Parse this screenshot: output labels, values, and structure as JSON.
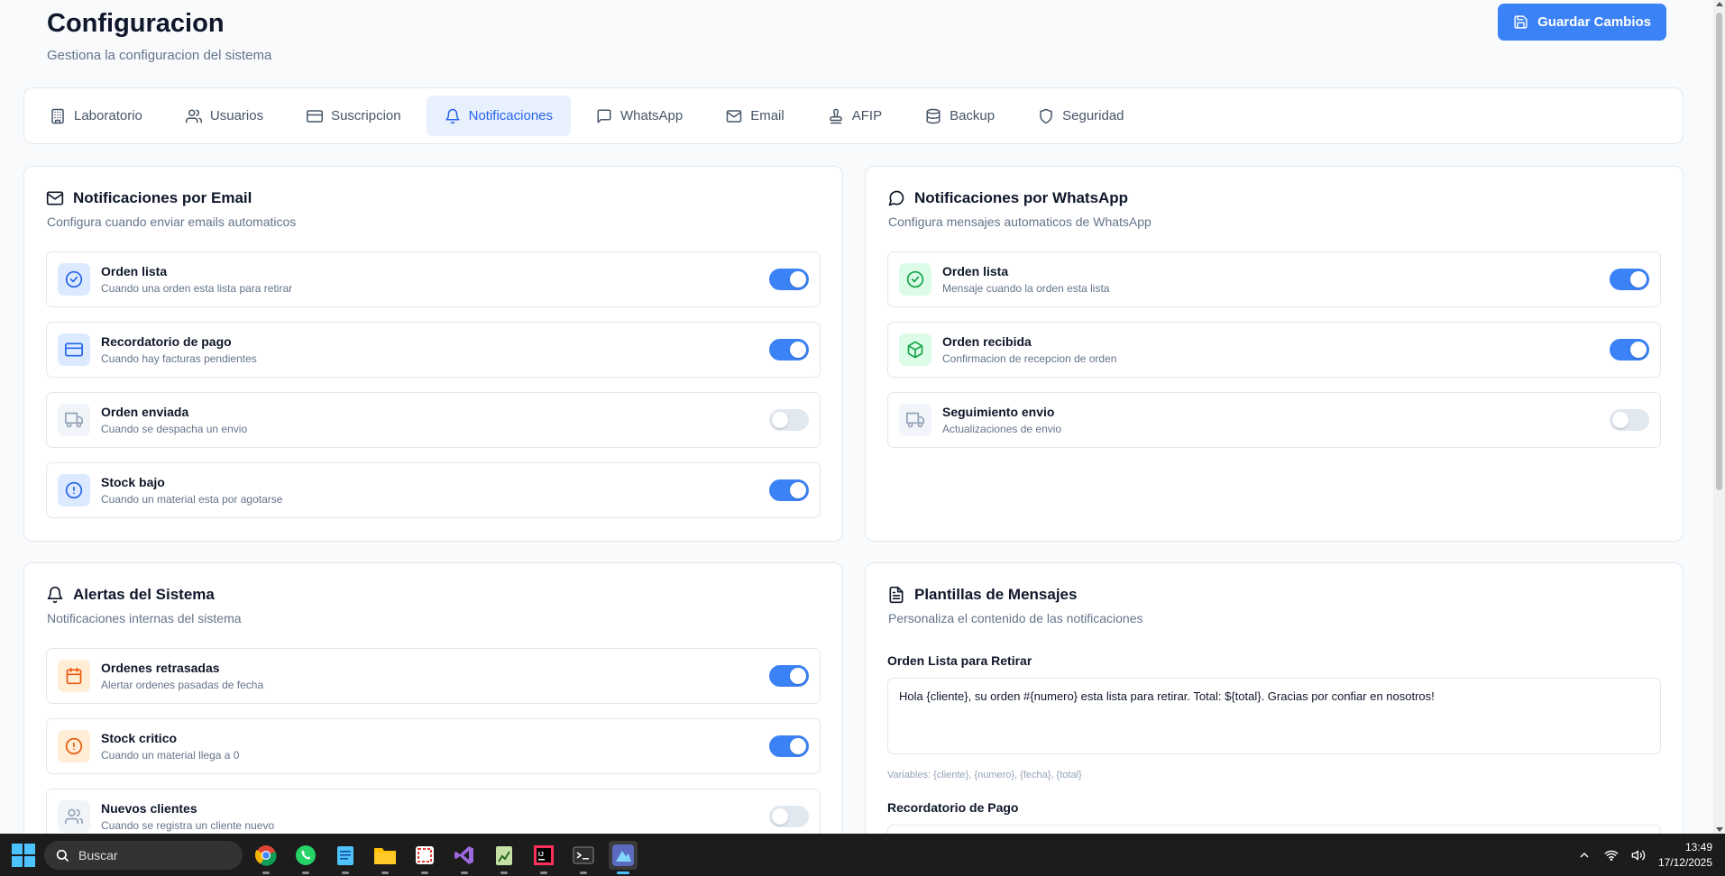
{
  "header": {
    "title": "Configuracion",
    "subtitle": "Gestiona la configuracion del sistema",
    "save_label": "Guardar Cambios"
  },
  "tabs": [
    {
      "label": "Laboratorio",
      "icon": "building-icon"
    },
    {
      "label": "Usuarios",
      "icon": "users-icon"
    },
    {
      "label": "Suscripcion",
      "icon": "credit-card-icon"
    },
    {
      "label": "Notificaciones",
      "icon": "bell-icon",
      "active": true
    },
    {
      "label": "WhatsApp",
      "icon": "message-icon"
    },
    {
      "label": "Email",
      "icon": "mail-icon"
    },
    {
      "label": "AFIP",
      "icon": "stamp-icon"
    },
    {
      "label": "Backup",
      "icon": "database-icon"
    },
    {
      "label": "Seguridad",
      "icon": "shield-icon"
    }
  ],
  "email_card": {
    "title": "Notificaciones por Email",
    "description": "Configura cuando enviar emails automaticos",
    "items": [
      {
        "label": "Orden lista",
        "sub": "Cuando una orden esta lista para retirar",
        "icon": "check-circle-icon",
        "enabled": true
      },
      {
        "label": "Recordatorio de pago",
        "sub": "Cuando hay facturas pendientes",
        "icon": "credit-card-icon",
        "enabled": true
      },
      {
        "label": "Orden enviada",
        "sub": "Cuando se despacha un envio",
        "icon": "truck-icon",
        "enabled": false
      },
      {
        "label": "Stock bajo",
        "sub": "Cuando un material esta por agotarse",
        "icon": "alert-circle-icon",
        "enabled": true
      }
    ]
  },
  "whatsapp_card": {
    "title": "Notificaciones por WhatsApp",
    "description": "Configura mensajes automaticos de WhatsApp",
    "items": [
      {
        "label": "Orden lista",
        "sub": "Mensaje cuando la orden esta lista",
        "icon": "check-circle-icon",
        "enabled": true
      },
      {
        "label": "Orden recibida",
        "sub": "Confirmacion de recepcion de orden",
        "icon": "package-icon",
        "enabled": true
      },
      {
        "label": "Seguimiento envio",
        "sub": "Actualizaciones de envio",
        "icon": "truck-icon",
        "enabled": false
      }
    ]
  },
  "alerts_card": {
    "title": "Alertas del Sistema",
    "description": "Notificaciones internas del sistema",
    "items": [
      {
        "label": "Ordenes retrasadas",
        "sub": "Alertar ordenes pasadas de fecha",
        "icon": "calendar-icon",
        "enabled": true
      },
      {
        "label": "Stock critico",
        "sub": "Cuando un material llega a 0",
        "icon": "alert-circle-icon",
        "enabled": true
      },
      {
        "label": "Nuevos clientes",
        "sub": "Cuando se registra un cliente nuevo",
        "icon": "users-icon",
        "enabled": false
      }
    ]
  },
  "templates_card": {
    "title": "Plantillas de Mensajes",
    "description": "Personaliza el contenido de las notificaciones",
    "template1_label": "Orden Lista para Retirar",
    "template1_value": "Hola {cliente}, su orden #{numero} esta lista para retirar. Total: ${total}. Gracias por confiar en nosotros!",
    "template1_vars": "Variables: {cliente}, {numero}, {fecha}, {total}",
    "template2_label": "Recordatorio de Pago"
  },
  "taskbar": {
    "search_placeholder": "Buscar",
    "time": "13:49",
    "date": "17/12/2025"
  },
  "colors": {
    "accent": "#3b82f6",
    "background": "#f8fafc"
  }
}
